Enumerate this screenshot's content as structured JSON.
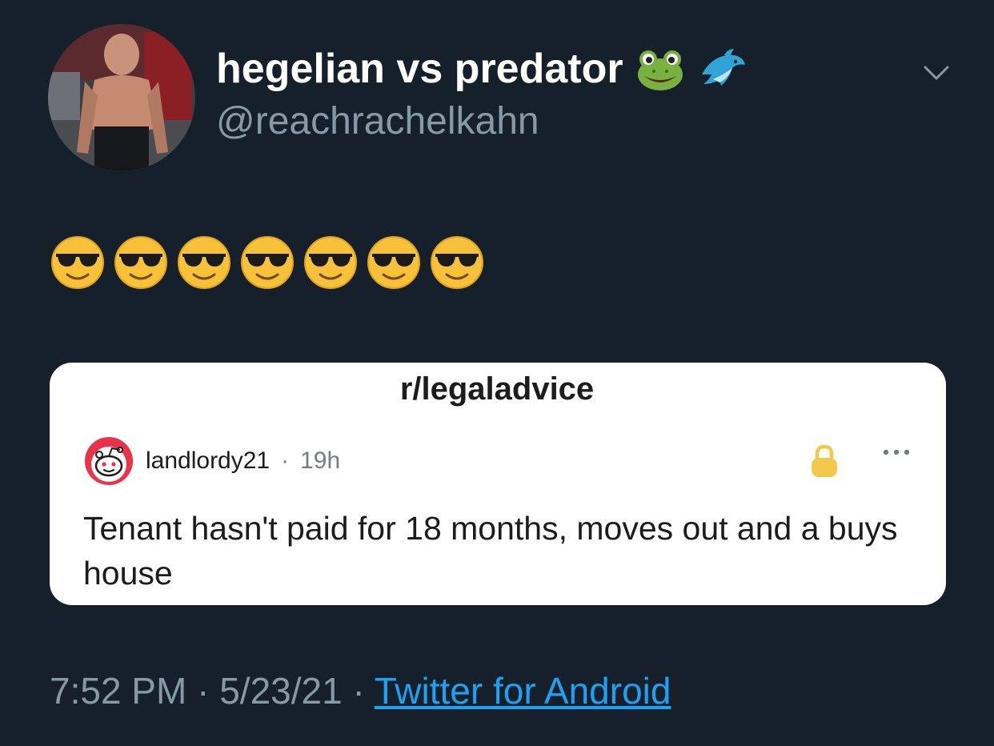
{
  "author": {
    "display_name": "hegelian vs predator",
    "name_emojis": [
      "frog-face",
      "dolphin"
    ],
    "handle": "@reachrachelkahn"
  },
  "tweet": {
    "emojis": [
      "smiling-face-with-sunglasses",
      "smiling-face-with-sunglasses",
      "smiling-face-with-sunglasses",
      "smiling-face-with-sunglasses",
      "smiling-face-with-sunglasses",
      "smiling-face-with-sunglasses",
      "smiling-face-with-sunglasses"
    ]
  },
  "quoted_post": {
    "subreddit": "r/legaladvice",
    "user": "landlordy21",
    "separator": "·",
    "time": "19h",
    "title": "Tenant hasn't paid for 18 months, moves out and a buys house",
    "icons": [
      "reddit-snoo-avatar",
      "lock-icon",
      "more-options-icon"
    ]
  },
  "footer": {
    "time": "7:52 PM",
    "separator": "·",
    "date": "5/23/21",
    "source": "Twitter for Android"
  },
  "colors": {
    "background": "#15202b",
    "secondary_text": "#8899a6",
    "link": "#1da1f2",
    "card_background": "#ffffff"
  }
}
